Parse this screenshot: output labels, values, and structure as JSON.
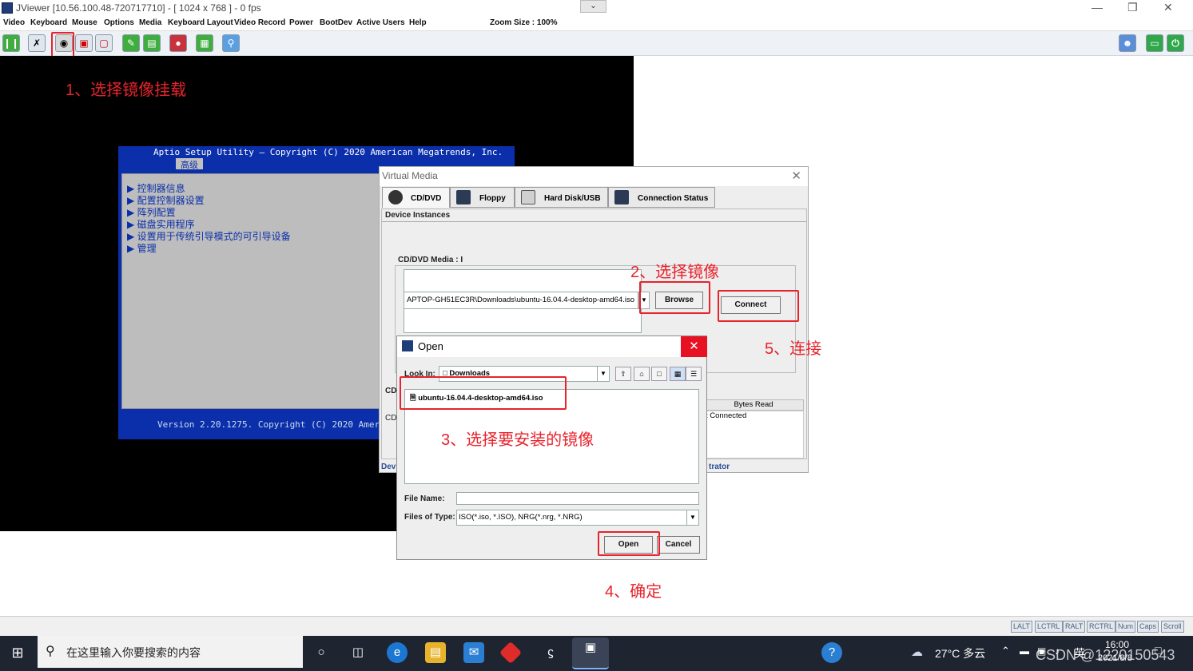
{
  "window": {
    "title": "JViewer [10.56.100.48-720717710] - [ 1024 x 768 ] - 0 fps"
  },
  "menu": {
    "items": [
      "Video",
      "Keyboard",
      "Mouse",
      "Options",
      "Media",
      "Keyboard Layout",
      "Video Record",
      "Power",
      "BootDev",
      "Active Users",
      "Help"
    ],
    "zoom_label": "Zoom Size : 100%"
  },
  "bios": {
    "header": "Aptio Setup Utility – Copyright (C) 2020 American Megatrends, Inc.",
    "tab": "高级",
    "items": [
      "控制器信息",
      "配置控制器设置",
      "阵列配置",
      "磁盘实用程序",
      "设置用于传统引导模式的可引导设备",
      "管理"
    ],
    "footer": "Version 2.20.1275. Copyright (C) 2020 America"
  },
  "annotations": {
    "step1": "1、选择镜像挂载",
    "step2": "2、选择镜像",
    "step3": "3、选择要安装的镜像",
    "step4": "4、确定",
    "step5": "5、连接"
  },
  "virtual_media": {
    "title": "Virtual Media",
    "tabs": [
      "CD/DVD",
      "Floppy",
      "Hard Disk/USB",
      "Connection Status"
    ],
    "device_instances_label": "Device Instances",
    "cddvd_media_label": "CD/DVD Media : I",
    "path_value": "APTOP-GH51EC3R\\Downloads\\ubuntu-16.04.4-desktop-amd64.iso",
    "browse_label": "Browse",
    "connect_label": "Connect",
    "cd_label_a": "CD",
    "cd_label_b": "CD",
    "bytes_read_header": "Bytes Read",
    "not_connected": "t Connected",
    "footer_left": "Devi",
    "footer_right": "trator"
  },
  "open_dialog": {
    "title": "Open",
    "look_in_label": "Look In:",
    "look_in_value": "Downloads",
    "file_item": "ubuntu-16.04.4-desktop-amd64.iso",
    "file_name_label": "File Name:",
    "file_name_value": "",
    "files_of_type_label": "Files of Type:",
    "files_of_type_value": "ISO(*.iso, *.ISO), NRG(*.nrg, *.NRG)",
    "open_label": "Open",
    "cancel_label": "Cancel"
  },
  "status_keys": [
    "LALT",
    "LCTRL",
    "RALT",
    "RCTRL",
    "Num",
    "Caps",
    "Scroll"
  ],
  "taskbar": {
    "search_placeholder": "在这里输入你要搜索的内容",
    "weather": "27°C 多云",
    "ime": "英",
    "time": "16:00",
    "date": "2021/8/8",
    "watermark": "CSDN @1220150543"
  },
  "colors": {
    "annotation_red": "#e8232c",
    "bios_blue": "#0b2faa",
    "taskbar": "#1e2430"
  }
}
